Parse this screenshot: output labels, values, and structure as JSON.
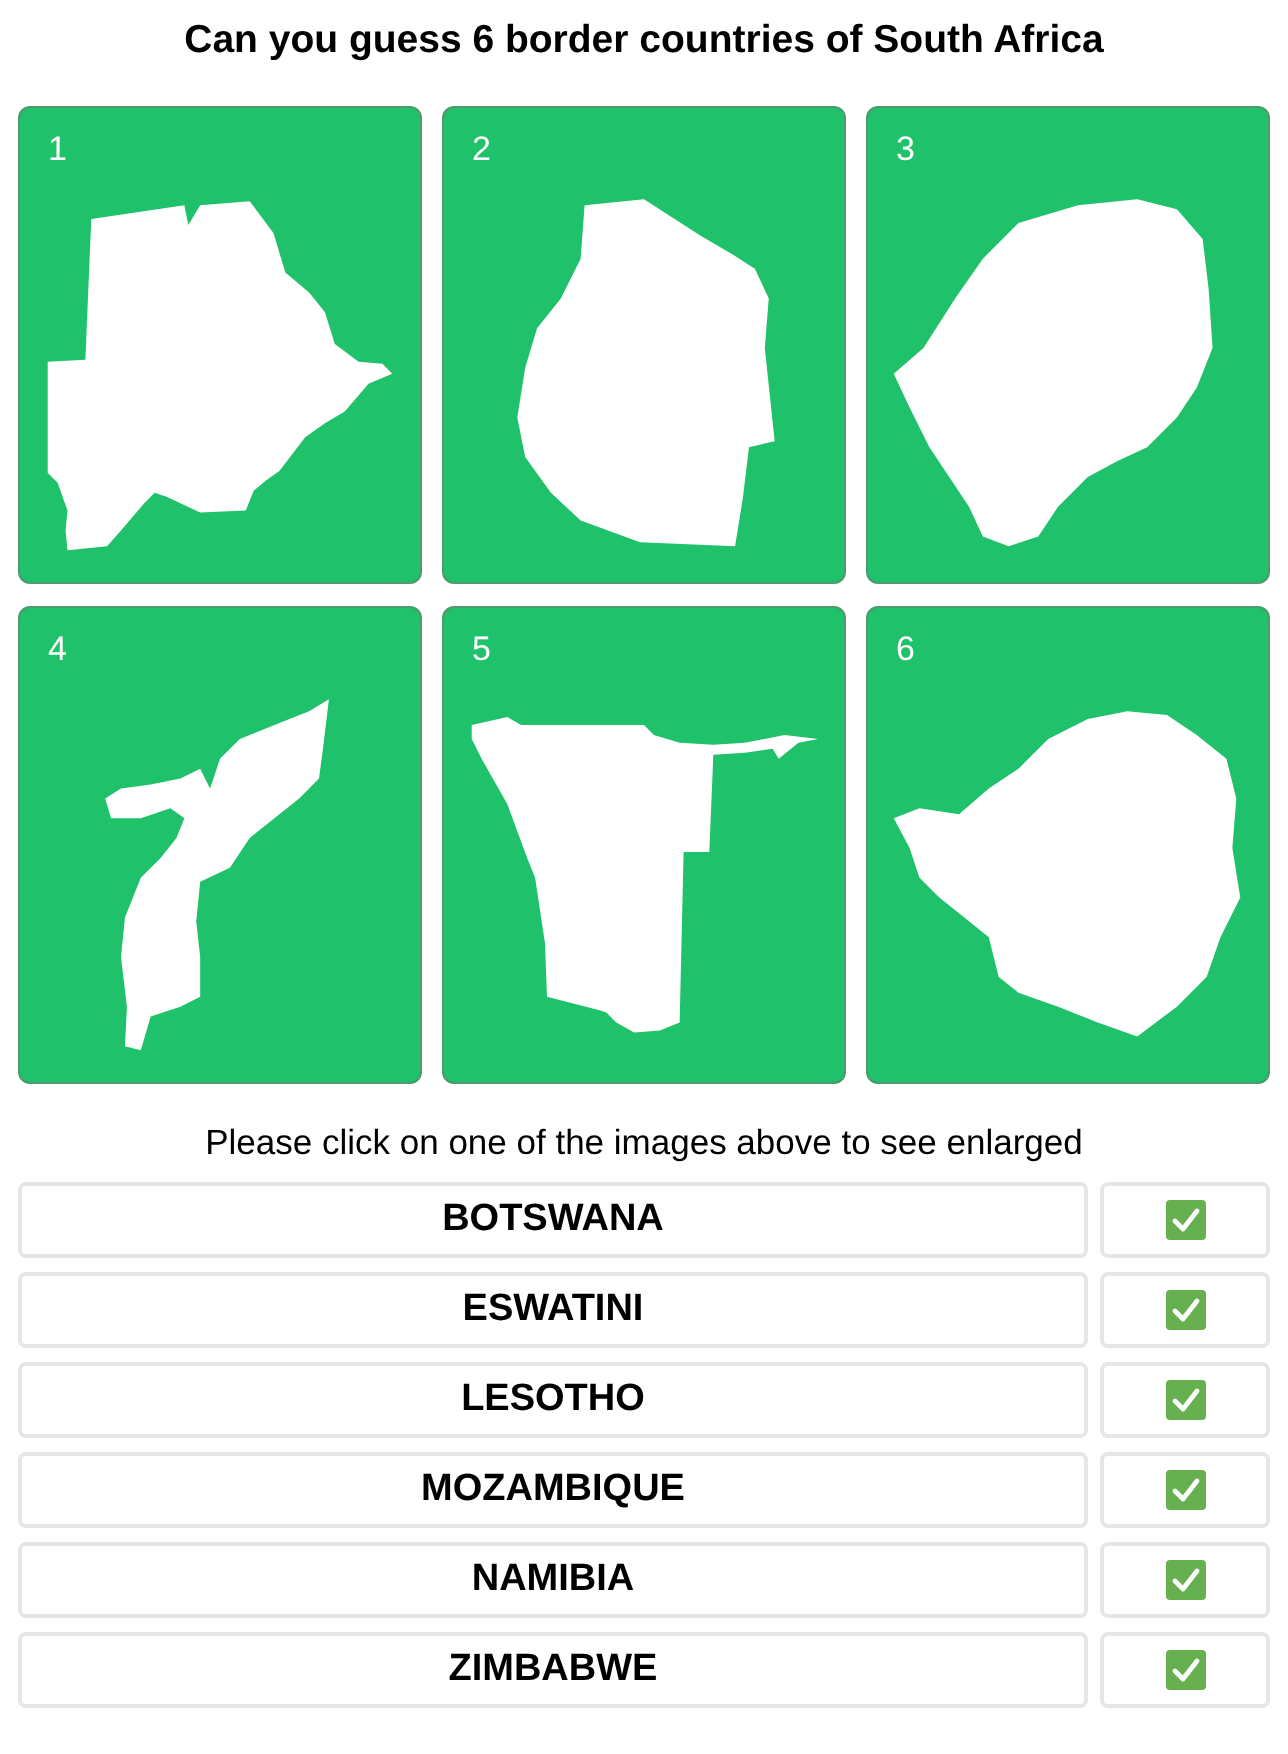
{
  "title": "Can you guess 6 border countries of South Africa",
  "cards": [
    {
      "number": "1"
    },
    {
      "number": "2"
    },
    {
      "number": "3"
    },
    {
      "number": "4"
    },
    {
      "number": "5"
    },
    {
      "number": "6"
    }
  ],
  "caption": "Please click on one of the images above to see enlarged",
  "answers": [
    {
      "name": "BOTSWANA",
      "correct": true
    },
    {
      "name": "ESWATINI",
      "correct": true
    },
    {
      "name": "LESOTHO",
      "correct": true
    },
    {
      "name": "MOZAMBIQUE",
      "correct": true
    },
    {
      "name": "NAMIBIA",
      "correct": true
    },
    {
      "name": "ZIMBABWE",
      "correct": true
    }
  ]
}
